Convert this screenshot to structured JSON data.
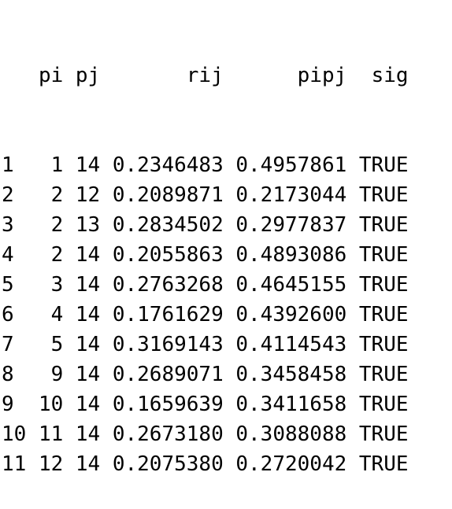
{
  "table": {
    "columns": [
      "pi",
      "pj",
      "rij",
      "pipj",
      "sig"
    ],
    "rows": [
      {
        "idx": "1",
        "pi": "1",
        "pj": "14",
        "rij": "0.2346483",
        "pipj": "0.4957861",
        "sig": "TRUE"
      },
      {
        "idx": "2",
        "pi": "2",
        "pj": "12",
        "rij": "0.2089871",
        "pipj": "0.2173044",
        "sig": "TRUE"
      },
      {
        "idx": "3",
        "pi": "2",
        "pj": "13",
        "rij": "0.2834502",
        "pipj": "0.2977837",
        "sig": "TRUE"
      },
      {
        "idx": "4",
        "pi": "2",
        "pj": "14",
        "rij": "0.2055863",
        "pipj": "0.4893086",
        "sig": "TRUE"
      },
      {
        "idx": "5",
        "pi": "3",
        "pj": "14",
        "rij": "0.2763268",
        "pipj": "0.4645155",
        "sig": "TRUE"
      },
      {
        "idx": "6",
        "pi": "4",
        "pj": "14",
        "rij": "0.1761629",
        "pipj": "0.4392600",
        "sig": "TRUE"
      },
      {
        "idx": "7",
        "pi": "5",
        "pj": "14",
        "rij": "0.3169143",
        "pipj": "0.4114543",
        "sig": "TRUE"
      },
      {
        "idx": "8",
        "pi": "9",
        "pj": "14",
        "rij": "0.2689071",
        "pipj": "0.3458458",
        "sig": "TRUE"
      },
      {
        "idx": "9",
        "pi": "10",
        "pj": "14",
        "rij": "0.1659639",
        "pipj": "0.3411658",
        "sig": "TRUE"
      },
      {
        "idx": "10",
        "pi": "11",
        "pj": "14",
        "rij": "0.2673180",
        "pipj": "0.3088088",
        "sig": "TRUE"
      },
      {
        "idx": "11",
        "pi": "12",
        "pj": "14",
        "rij": "0.2075380",
        "pipj": "0.2720042",
        "sig": "TRUE"
      }
    ]
  }
}
